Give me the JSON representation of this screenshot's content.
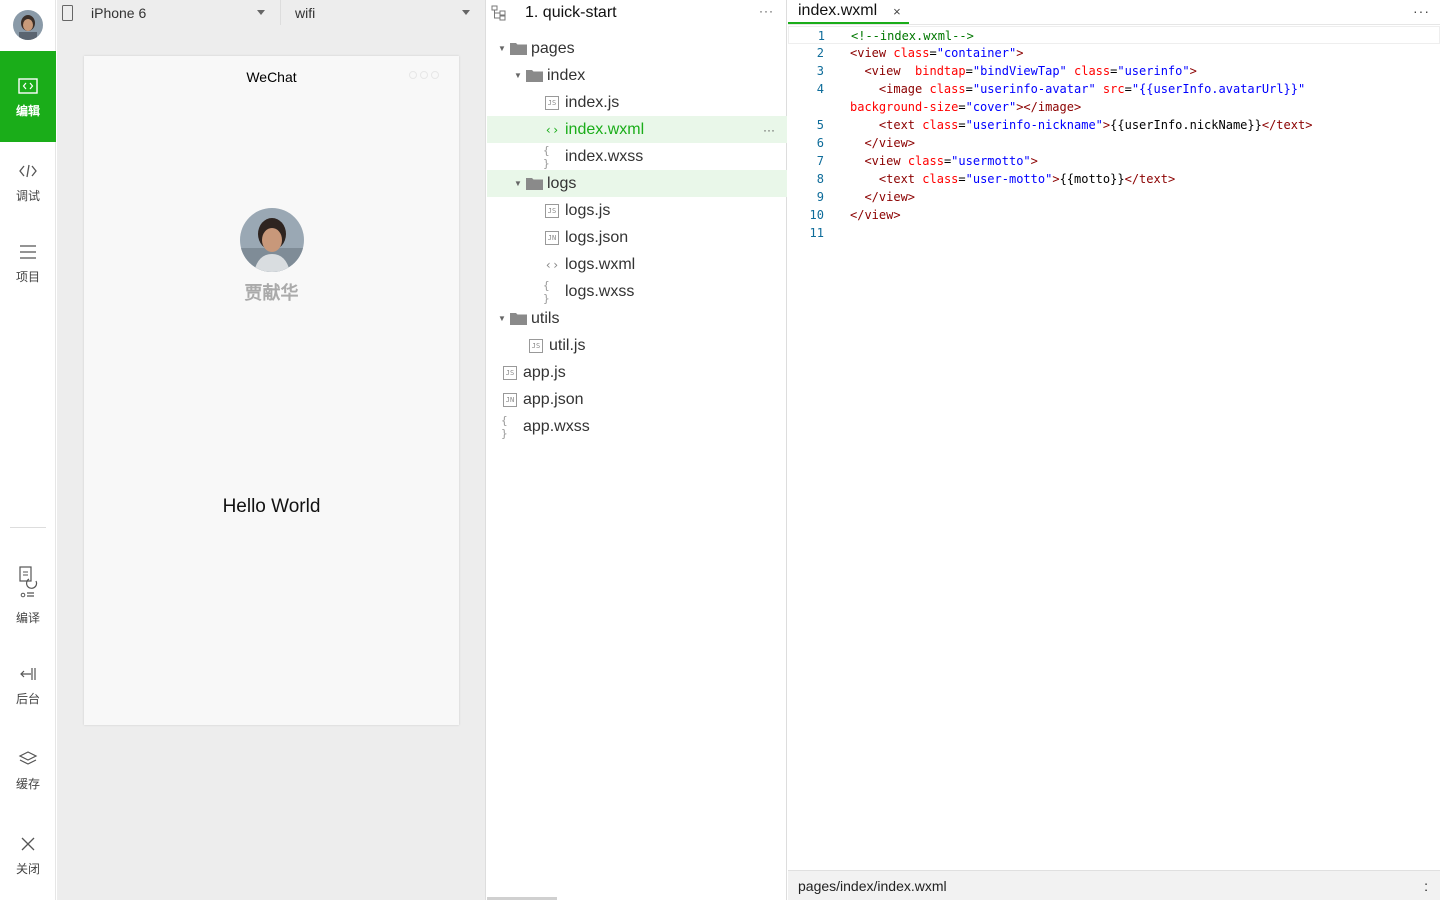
{
  "activity": {
    "items": [
      {
        "label": "编辑",
        "icon": "code-window-icon",
        "active": true
      },
      {
        "label": "调试",
        "icon": "code-brackets-icon",
        "active": false
      },
      {
        "label": "项目",
        "icon": "menu-lines-icon",
        "active": false
      },
      {
        "label": "编译",
        "icon": "compile-icon",
        "active": false
      },
      {
        "label": "后台",
        "icon": "background-icon",
        "active": false
      },
      {
        "label": "缓存",
        "icon": "layers-icon",
        "active": false
      },
      {
        "label": "关闭",
        "icon": "close-icon",
        "active": false
      }
    ]
  },
  "simulator": {
    "device": "iPhone 6",
    "network": "wifi",
    "nav_title": "WeChat",
    "nickname": "贾献华",
    "motto": "Hello World"
  },
  "tree": {
    "project_title": "1. quick-start",
    "more": "···",
    "nodes": [
      {
        "name": "pages",
        "type": "folder",
        "depth": 0,
        "open": true
      },
      {
        "name": "index",
        "type": "folder",
        "depth": 1,
        "open": true
      },
      {
        "name": "index.js",
        "type": "js",
        "depth": 2
      },
      {
        "name": "index.wxml",
        "type": "wxml",
        "depth": 2,
        "selected": true
      },
      {
        "name": "index.wxss",
        "type": "wxss",
        "depth": 2
      },
      {
        "name": "logs",
        "type": "folder",
        "depth": 1,
        "open": true,
        "hover": true
      },
      {
        "name": "logs.js",
        "type": "js",
        "depth": 2
      },
      {
        "name": "logs.json",
        "type": "json",
        "depth": 2
      },
      {
        "name": "logs.wxml",
        "type": "wxml",
        "depth": 2
      },
      {
        "name": "logs.wxss",
        "type": "wxss",
        "depth": 2
      },
      {
        "name": "utils",
        "type": "folder",
        "depth": 0,
        "open": true
      },
      {
        "name": "util.js",
        "type": "js",
        "depth": 1
      },
      {
        "name": "app.js",
        "type": "js",
        "depth": -1
      },
      {
        "name": "app.json",
        "type": "json",
        "depth": -1
      },
      {
        "name": "app.wxss",
        "type": "wxss",
        "depth": -1
      }
    ]
  },
  "editor": {
    "tab": "index.wxml",
    "tab_close": "×",
    "more": "···",
    "status_path": "pages/index/index.wxml",
    "status_right": ":",
    "lines": [
      [
        [
          "cm",
          "<!--index.wxml-->"
        ]
      ],
      [
        [
          "tg",
          "<view "
        ],
        [
          "at",
          "class"
        ],
        [
          "pl",
          "="
        ],
        [
          "st",
          "\"container\""
        ],
        [
          "tg",
          ">"
        ]
      ],
      [
        [
          "pl",
          "  "
        ],
        [
          "tg",
          "<view  "
        ],
        [
          "at",
          "bindtap"
        ],
        [
          "pl",
          "="
        ],
        [
          "st",
          "\"bindViewTap\""
        ],
        [
          "pl",
          " "
        ],
        [
          "at",
          "class"
        ],
        [
          "pl",
          "="
        ],
        [
          "st",
          "\"userinfo\""
        ],
        [
          "tg",
          ">"
        ]
      ],
      [
        [
          "pl",
          "    "
        ],
        [
          "tg",
          "<image "
        ],
        [
          "at",
          "class"
        ],
        [
          "pl",
          "="
        ],
        [
          "st",
          "\"userinfo-avatar\""
        ],
        [
          "pl",
          " "
        ],
        [
          "at",
          "src"
        ],
        [
          "pl",
          "="
        ],
        [
          "st",
          "\"{{userInfo.avatarUrl}}\""
        ]
      ],
      [
        [
          "at",
          "background-size"
        ],
        [
          "pl",
          "="
        ],
        [
          "st",
          "\"cover\""
        ],
        [
          "tg",
          "></image>"
        ]
      ],
      [
        [
          "pl",
          "    "
        ],
        [
          "tg",
          "<text "
        ],
        [
          "at",
          "class"
        ],
        [
          "pl",
          "="
        ],
        [
          "st",
          "\"userinfo-nickname\""
        ],
        [
          "tg",
          ">"
        ],
        [
          "pl",
          "{{userInfo.nickName}}"
        ],
        [
          "tg",
          "</text>"
        ]
      ],
      [
        [
          "pl",
          "  "
        ],
        [
          "tg",
          "</view>"
        ]
      ],
      [
        [
          "pl",
          "  "
        ],
        [
          "tg",
          "<view "
        ],
        [
          "at",
          "class"
        ],
        [
          "pl",
          "="
        ],
        [
          "st",
          "\"usermotto\""
        ],
        [
          "tg",
          ">"
        ]
      ],
      [
        [
          "pl",
          "    "
        ],
        [
          "tg",
          "<text "
        ],
        [
          "at",
          "class"
        ],
        [
          "pl",
          "="
        ],
        [
          "st",
          "\"user-motto\""
        ],
        [
          "tg",
          ">"
        ],
        [
          "pl",
          "{{motto}}"
        ],
        [
          "tg",
          "</text>"
        ]
      ],
      [
        [
          "pl",
          "  "
        ],
        [
          "tg",
          "</view>"
        ]
      ],
      [
        [
          "tg",
          "</view>"
        ]
      ],
      []
    ],
    "line_numbers": [
      "1",
      "2",
      "3",
      "4",
      "",
      "5",
      "6",
      "7",
      "8",
      "9",
      "10",
      "11"
    ]
  }
}
